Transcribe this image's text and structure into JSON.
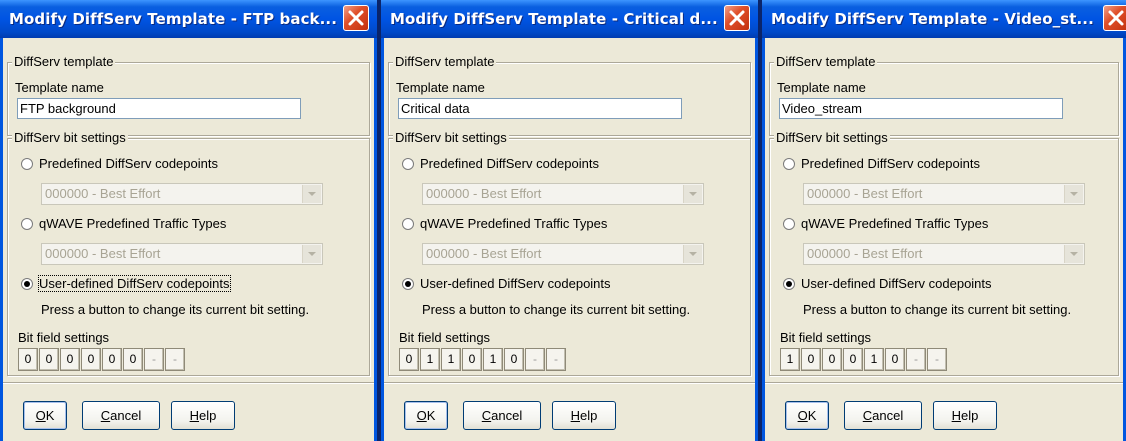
{
  "dialogs": [
    {
      "title": "Modify DiffServ Template - FTP back...",
      "group_template": "DiffServ template",
      "template_name_label": "Template name",
      "template_name_value": "FTP background",
      "group_bits": "DiffServ bit settings",
      "radio_predefined": "Predefined DiffServ codepoints",
      "combo_predefined": "000000 - Best Effort",
      "radio_qwave": "qWAVE Predefined Traffic Types",
      "combo_qwave": "000000 - Best Effort",
      "radio_user": "User-defined DiffServ codepoints",
      "hint": "Press a button to change its current bit setting.",
      "bitfield_label": "Bit field settings",
      "bits": [
        "0",
        "0",
        "0",
        "0",
        "0",
        "0",
        "-",
        "-"
      ],
      "ok": {
        "pre": "",
        "accel": "O",
        "post": "K"
      },
      "cancel": {
        "pre": "",
        "accel": "C",
        "post": "ancel"
      },
      "help": {
        "pre": "",
        "accel": "H",
        "post": "elp"
      }
    },
    {
      "title": "Modify DiffServ Template - Critical d...",
      "group_template": "DiffServ template",
      "template_name_label": "Template name",
      "template_name_value": "Critical data",
      "group_bits": "DiffServ bit settings",
      "radio_predefined": "Predefined DiffServ codepoints",
      "combo_predefined": "000000 - Best Effort",
      "radio_qwave": "qWAVE Predefined Traffic Types",
      "combo_qwave": "000000 - Best Effort",
      "radio_user": "User-defined DiffServ codepoints",
      "hint": "Press a button to change its current bit setting.",
      "bitfield_label": "Bit field settings",
      "bits": [
        "0",
        "1",
        "1",
        "0",
        "1",
        "0",
        "-",
        "-"
      ],
      "ok": {
        "pre": "",
        "accel": "O",
        "post": "K"
      },
      "cancel": {
        "pre": "",
        "accel": "C",
        "post": "ancel"
      },
      "help": {
        "pre": "",
        "accel": "H",
        "post": "elp"
      }
    },
    {
      "title": "Modify DiffServ Template - Video_st...",
      "group_template": "DiffServ template",
      "template_name_label": "Template name",
      "template_name_value": "Video_stream",
      "group_bits": "DiffServ bit settings",
      "radio_predefined": "Predefined DiffServ codepoints",
      "combo_predefined": "000000 - Best Effort",
      "radio_qwave": "qWAVE Predefined Traffic Types",
      "combo_qwave": "000000 - Best Effort",
      "radio_user": "User-defined DiffServ codepoints",
      "hint": "Press a button to change its current bit setting.",
      "bitfield_label": "Bit field settings",
      "bits": [
        "1",
        "0",
        "0",
        "0",
        "1",
        "0",
        "-",
        "-"
      ],
      "ok": {
        "pre": "",
        "accel": "O",
        "post": "K"
      },
      "cancel": {
        "pre": "",
        "accel": "C",
        "post": "ancel"
      },
      "help": {
        "pre": "",
        "accel": "H",
        "post": "elp"
      }
    }
  ],
  "selected_radio": "user-defined",
  "colors": {
    "titlebar": "#0054e3",
    "client": "#ece9d8",
    "close_button": "#e0502b"
  },
  "icons": {
    "close": "close-icon"
  }
}
